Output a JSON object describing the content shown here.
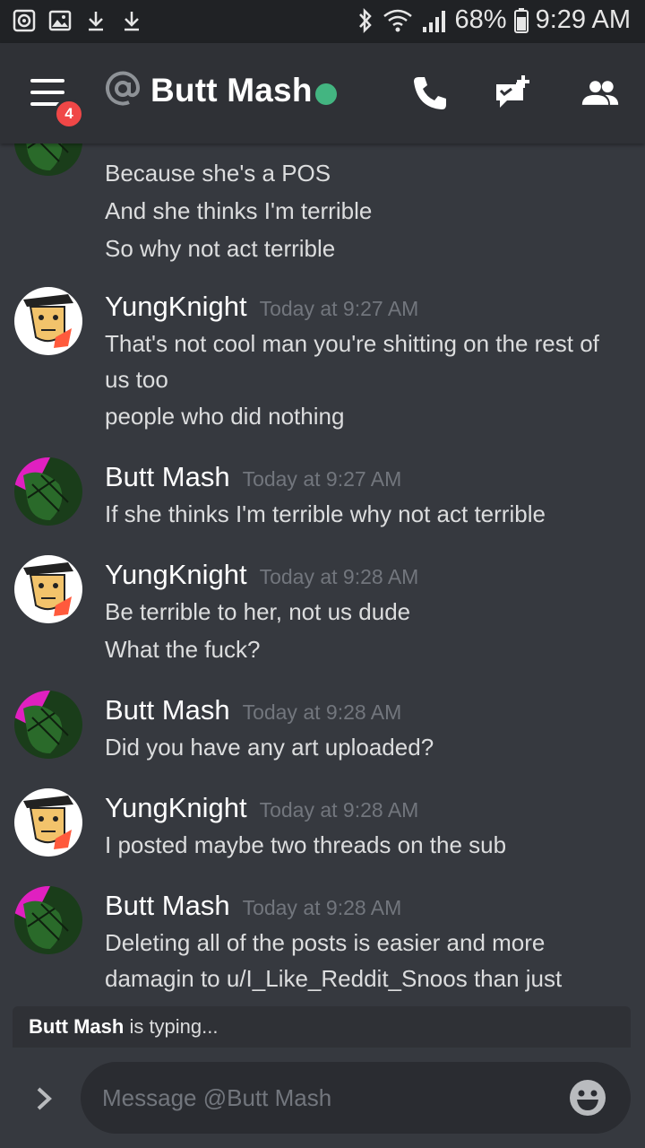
{
  "status_bar": {
    "battery": "68%",
    "time": "9:29 AM",
    "icons": [
      "media-icon",
      "gallery-icon",
      "download-icon",
      "download-icon",
      "bluetooth-icon",
      "wifi-icon",
      "signal-icon",
      "battery-icon"
    ]
  },
  "header": {
    "menu_badge": "4",
    "channel_name": "Butt Mash",
    "status": "online",
    "actions": [
      "phone-icon",
      "add-message-icon",
      "members-icon"
    ]
  },
  "messages": [
    {
      "author": "",
      "timestamp": "",
      "avatar": "butt-mash-avatar",
      "lines": [
        "Because she's a POS",
        "And she thinks I'm terrible",
        "So why not act terrible"
      ]
    },
    {
      "author": "YungKnight",
      "timestamp": "Today at 9:27 AM",
      "avatar": "yungknight-avatar",
      "lines": [
        "That's not cool man you're shitting on the rest of",
        "us too",
        "people who did nothing"
      ]
    },
    {
      "author": "Butt Mash",
      "timestamp": "Today at 9:27 AM",
      "avatar": "butt-mash-avatar",
      "lines": [
        "If she thinks I'm terrible why not act terrible"
      ]
    },
    {
      "author": "YungKnight",
      "timestamp": "Today at 9:28 AM",
      "avatar": "yungknight-avatar",
      "lines": [
        "Be terrible to her, not us dude",
        "What the fuck?"
      ]
    },
    {
      "author": "Butt Mash",
      "timestamp": "Today at 9:28 AM",
      "avatar": "butt-mash-avatar",
      "lines": [
        "Did you have any art uploaded?"
      ]
    },
    {
      "author": "YungKnight",
      "timestamp": "Today at 9:28 AM",
      "avatar": "yungknight-avatar",
      "lines": [
        "I posted maybe two threads on the sub"
      ]
    },
    {
      "author": "Butt Mash",
      "timestamp": "Today at 9:28 AM",
      "avatar": "butt-mash-avatar",
      "lines": [
        "Deleting all of the posts is easier and more",
        "damagin to u/I_Like_Reddit_Snoos than just"
      ]
    }
  ],
  "typing": {
    "user": "Butt Mash",
    "text": " is typing..."
  },
  "composer": {
    "placeholder": "Message @Butt Mash"
  },
  "colors": {
    "background": "#36393f",
    "header": "#2f3136",
    "status_bar": "#202225",
    "online": "#43b581",
    "badge": "#f04747",
    "timestamp": "#72767d"
  }
}
